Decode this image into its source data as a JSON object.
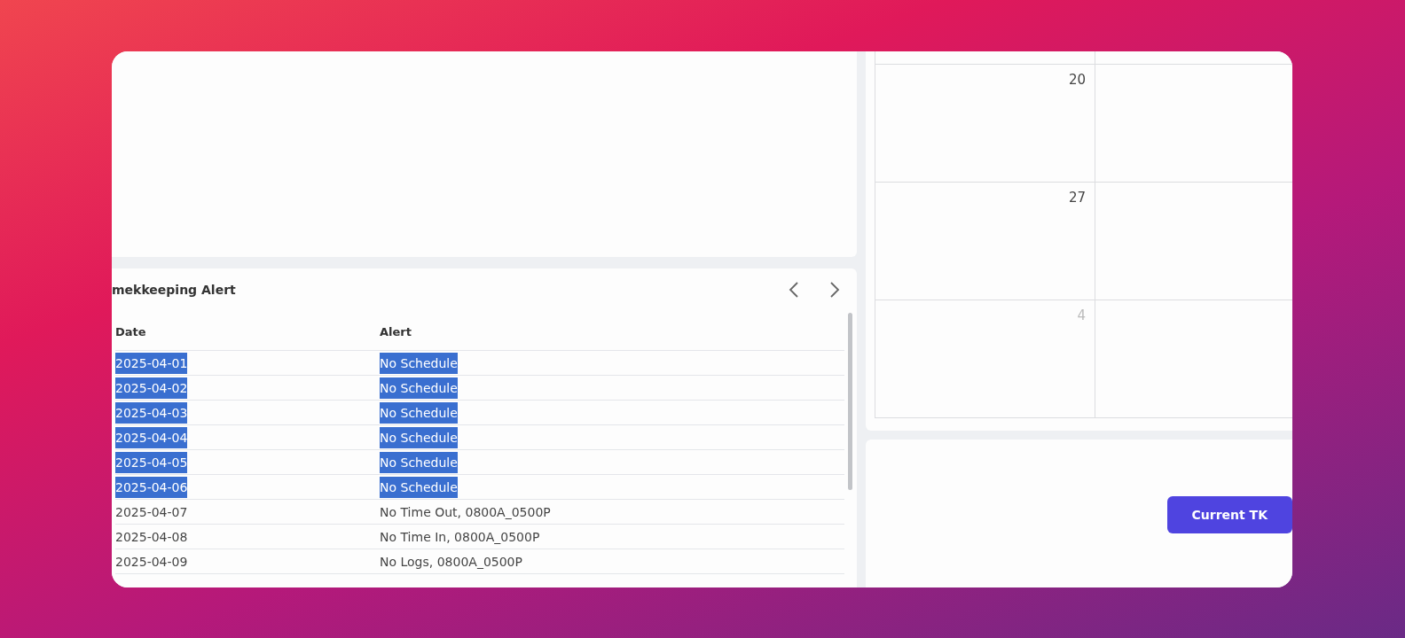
{
  "alerts": {
    "title": "mekkeeping Alert",
    "columns": [
      "Date",
      "Alert"
    ],
    "rows": [
      {
        "date": "2025-04-01",
        "alert": "No Schedule",
        "selected": true
      },
      {
        "date": "2025-04-02",
        "alert": "No Schedule",
        "selected": true
      },
      {
        "date": "2025-04-03",
        "alert": "No Schedule",
        "selected": true
      },
      {
        "date": "2025-04-04",
        "alert": "No Schedule",
        "selected": true
      },
      {
        "date": "2025-04-05",
        "alert": "No Schedule",
        "selected": true
      },
      {
        "date": "2025-04-06",
        "alert": "No Schedule",
        "selected": true
      },
      {
        "date": "2025-04-07",
        "alert": "No Time Out, 0800A_0500P",
        "selected": false
      },
      {
        "date": "2025-04-08",
        "alert": "No Time In, 0800A_0500P",
        "selected": false
      },
      {
        "date": "2025-04-09",
        "alert": "No Logs, 0800A_0500P",
        "selected": false
      }
    ]
  },
  "calendar": {
    "weeks": [
      {
        "day": "20",
        "muted": false
      },
      {
        "day": "27",
        "muted": false
      },
      {
        "day": "4",
        "muted": true
      }
    ]
  },
  "button": "Current TK"
}
